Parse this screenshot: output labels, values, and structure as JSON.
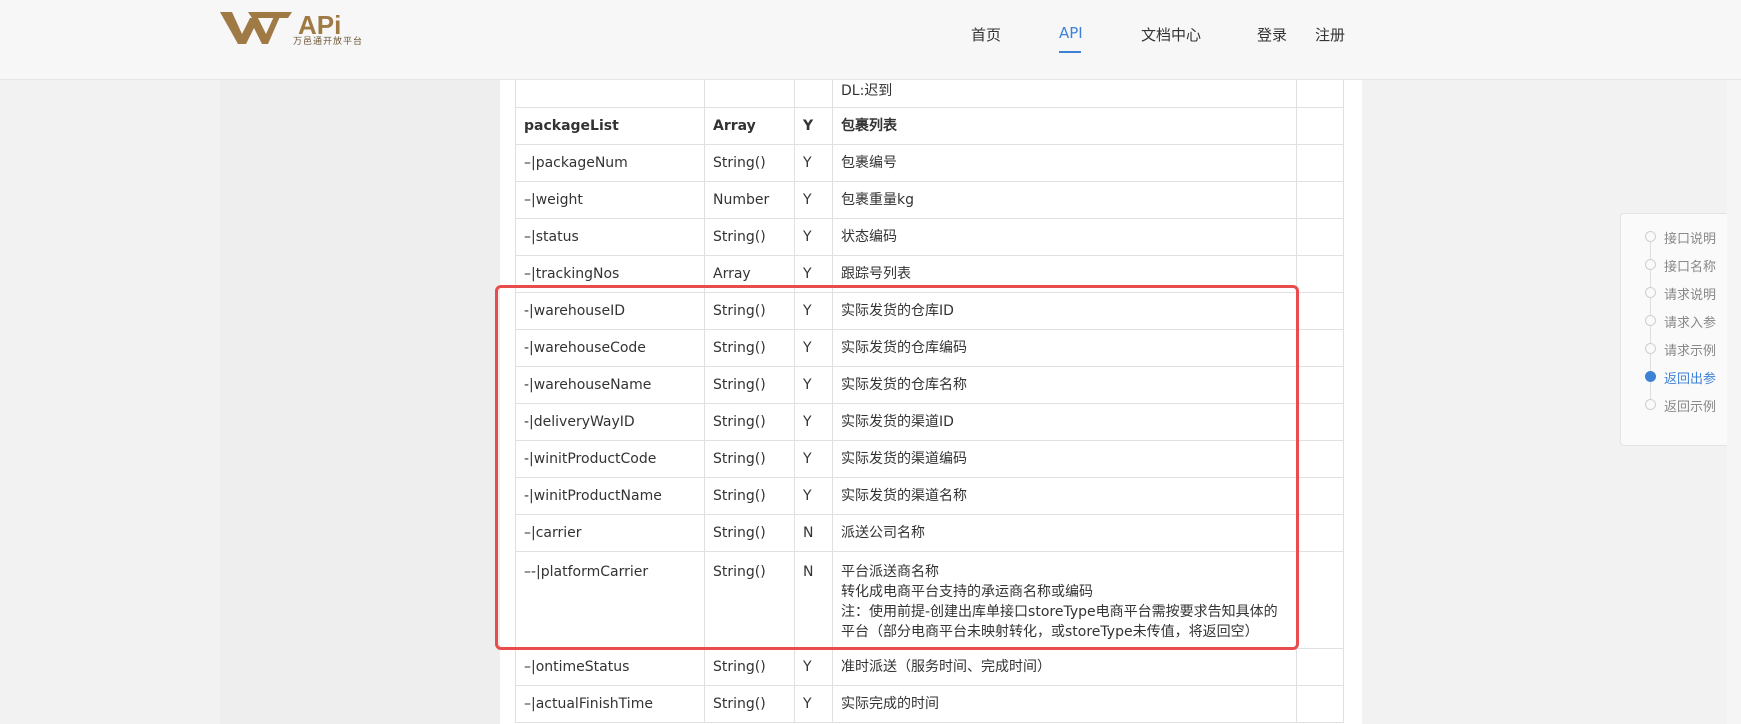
{
  "header": {
    "logo_subtitle": "万邑通开放平台",
    "nav": [
      {
        "label": "首页"
      },
      {
        "label": "API"
      },
      {
        "label": "文档中心"
      },
      {
        "label": "登录"
      },
      {
        "label": "注册"
      }
    ],
    "active_nav": "API"
  },
  "table": {
    "rows": [
      {
        "name": "",
        "type": "",
        "req": "",
        "desc": [
          "DL:迟到"
        ],
        "note": ""
      },
      {
        "name": "packageList",
        "type": "Array",
        "req": "Y",
        "desc": [
          "包裹列表"
        ],
        "note": ""
      },
      {
        "name": "–|packageNum",
        "type": "String()",
        "req": "Y",
        "desc": [
          "包裹编号"
        ],
        "note": ""
      },
      {
        "name": "–|weight",
        "type": "Number",
        "req": "Y",
        "desc": [
          "包裹重量kg"
        ],
        "note": ""
      },
      {
        "name": "–|status",
        "type": "String()",
        "req": "Y",
        "desc": [
          "状态编码"
        ],
        "note": ""
      },
      {
        "name": "–|trackingNos",
        "type": "Array",
        "req": "Y",
        "desc": [
          "跟踪号列表"
        ],
        "note": ""
      },
      {
        "name": "-|warehouseID",
        "type": "String()",
        "req": "Y",
        "desc": [
          "实际发货的仓库ID"
        ],
        "note": ""
      },
      {
        "name": "-|warehouseCode",
        "type": "String()",
        "req": "Y",
        "desc": [
          "实际发货的仓库编码"
        ],
        "note": ""
      },
      {
        "name": "-|warehouseName",
        "type": "String()",
        "req": "Y",
        "desc": [
          "实际发货的仓库名称"
        ],
        "note": ""
      },
      {
        "name": "-|deliveryWayID",
        "type": "String()",
        "req": "Y",
        "desc": [
          "实际发货的渠道ID"
        ],
        "note": ""
      },
      {
        "name": "-|winitProductCode",
        "type": "String()",
        "req": "Y",
        "desc": [
          "实际发货的渠道编码"
        ],
        "note": ""
      },
      {
        "name": "-|winitProductName",
        "type": "String()",
        "req": "Y",
        "desc": [
          "实际发货的渠道名称"
        ],
        "note": ""
      },
      {
        "name": "–|carrier",
        "type": "String()",
        "req": "N",
        "desc": [
          "派送公司名称"
        ],
        "note": ""
      },
      {
        "name": "–-|platformCarrier",
        "type": "String()",
        "req": "N",
        "desc": [
          "平台派送商名称",
          "转化成电商平台支持的承运商名称或编码",
          "注：使用前提-创建出库单接口storeType电商平台需按要求告知具体的",
          "平台（部分电商平台未映射转化，或storeType未传值，将返回空）"
        ],
        "note": ""
      },
      {
        "name": "–|ontimeStatus",
        "type": "String()",
        "req": "Y",
        "desc": [
          "准时派送（服务时间、完成时间）"
        ],
        "note": ""
      },
      {
        "name": "–|actualFinishTime",
        "type": "String()",
        "req": "Y",
        "desc": [
          "实际完成的时间"
        ],
        "note": ""
      }
    ]
  },
  "toc": {
    "items": [
      "接口说明",
      "接口名称",
      "请求说明",
      "请求入参",
      "请求示例",
      "返回出参",
      "返回示例"
    ],
    "active": "返回出参"
  },
  "colors": {
    "accent": "#3e82d6",
    "highlight": "#e84c4c",
    "logo": "#a07a45"
  }
}
